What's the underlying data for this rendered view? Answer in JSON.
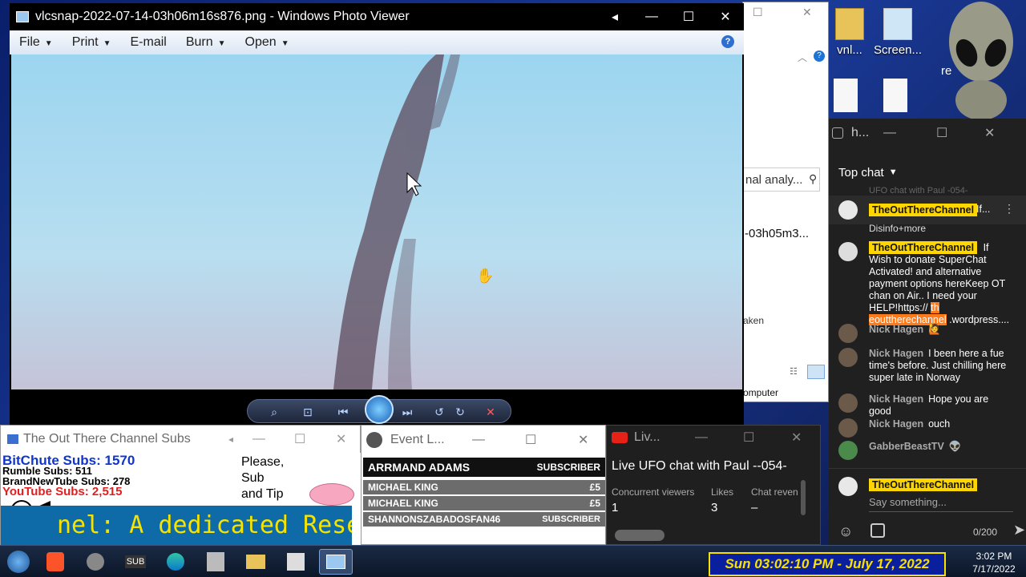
{
  "desktop": {
    "icons": [
      {
        "label": "vnl...",
        "kind": "folder"
      },
      {
        "label": "Screen...",
        "kind": "app"
      },
      {
        "label": "re",
        "kind": "alien"
      }
    ]
  },
  "explorer": {
    "search_text": "nal analy...",
    "file_name": "-03h05m3...",
    "detail": "aken",
    "footer": "omputer"
  },
  "photo_viewer": {
    "title": "vlcsnap-2022-07-14-03h06m16s876.png - Windows Photo Viewer",
    "menu": [
      "File",
      "Print",
      "E-mail",
      "Burn",
      "Open"
    ],
    "help": "?"
  },
  "subs_window": {
    "title": "The Out There Channel Subs",
    "bitchute": "BitChute Subs: 1570",
    "rumble": "Rumble Subs: 511",
    "brandnew": "BrandNewTube Subs: 278",
    "youtube": "YouTube Subs: 2,515",
    "please": [
      "Please,",
      "Sub",
      "and Tip"
    ],
    "banner": "nel: A dedicated Researc"
  },
  "event_window": {
    "title": "Event L...",
    "rows": [
      {
        "name": "ARRMAND ADAMS",
        "value": "SUBSCRIBER"
      },
      {
        "name": "MICHAEL KING",
        "value": "£5"
      },
      {
        "name": "MICHAEL KING",
        "value": "£5"
      },
      {
        "name": "SHANNONSZABADOSFAN46",
        "value": "SUBSCRIBER"
      }
    ]
  },
  "yt_window": {
    "title": "Liv...",
    "stream_title": "Live UFO chat with Paul --054-",
    "stats": [
      {
        "label": "Concurrent viewers",
        "value": "1"
      },
      {
        "label": "Likes",
        "value": "3"
      },
      {
        "label": "Chat reven",
        "value": "–"
      }
    ]
  },
  "chat": {
    "window_title": "h...",
    "header": "Top chat",
    "pinned_owner": "TheOutThereChannel",
    "pinned_snippet": "If...",
    "faded_line": "UFO chat with Paul -054-",
    "disinfo_line": "Disinfo+more",
    "messages": [
      {
        "author": "TheOutThereChannel",
        "owner": true,
        "text": "If Wish to donate SuperChat Activated! and alternative payment options hereKeep OT chan on Air.. I need your HELP!",
        "link1": "https://",
        "link2": "th eouttherechannel",
        "link3": ".wordpress...."
      },
      {
        "author": "Nick Hagen",
        "owner": false,
        "text": "🙋"
      },
      {
        "author": "Nick Hagen",
        "owner": false,
        "text": "I been here a fue time's before. Just chilling here super late in Norway"
      },
      {
        "author": "Nick Hagen",
        "owner": false,
        "text": "Hope you are good"
      },
      {
        "author": "Nick Hagen",
        "owner": false,
        "text": "ouch"
      },
      {
        "author": "GabberBeastTV",
        "owner": false,
        "text": "👽"
      }
    ],
    "input_owner": "TheOutThereChannel",
    "input_placeholder": "Say something...",
    "char_count": "0/200"
  },
  "taskbar": {
    "banner": "Sun 03:02:10 PM - July 17, 2022",
    "time": "3:02 PM",
    "date": "7/17/2022",
    "sub_label": "SUB"
  }
}
